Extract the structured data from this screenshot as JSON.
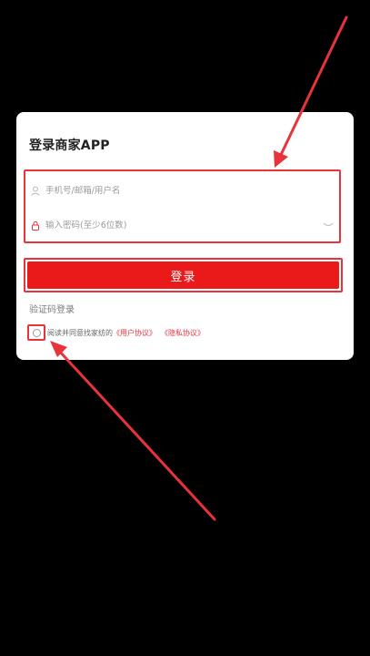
{
  "login": {
    "title": "登录商家APP",
    "username_placeholder": "手机号/邮箱/用户名",
    "password_placeholder": "输入密码(至少6位数)",
    "submit_label": "登录",
    "sms_login_label": "验证码登录",
    "agreement": {
      "prefix": "阅读并同意找家纺的",
      "user_agreement": "《用户协议》",
      "privacy_policy": "《隐私协议》"
    }
  },
  "icons": {
    "username": "user-icon",
    "password": "lock-icon",
    "visibility": "eye-closed-icon",
    "checkbox": "circle-checkbox"
  },
  "colors": {
    "background": "#000000",
    "card": "#ffffff",
    "accent": "#ea1a1a",
    "highlight": "#e8333a"
  }
}
